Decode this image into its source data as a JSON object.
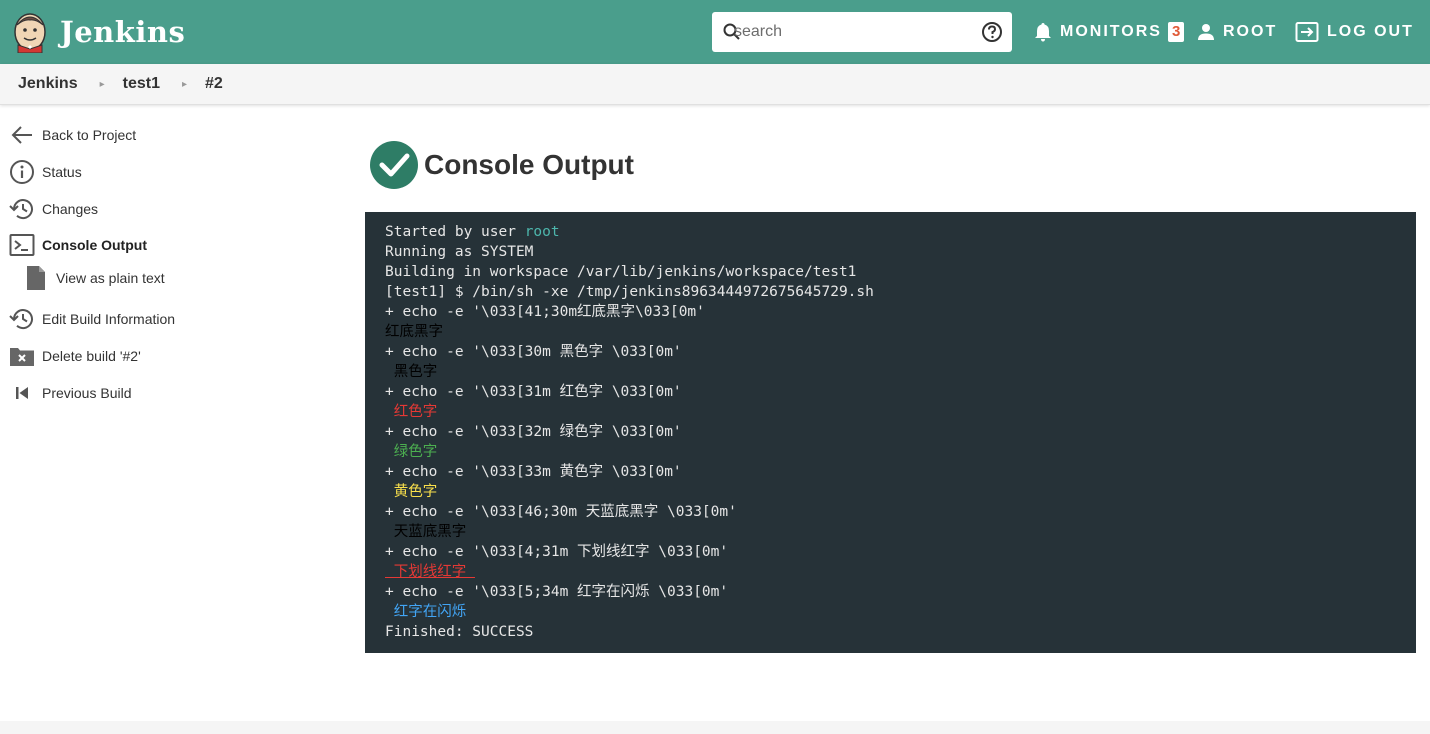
{
  "header": {
    "logo_text": "Jenkins",
    "search": {
      "placeholder": "search",
      "value": ""
    },
    "monitors_label": "MONITORS",
    "monitors_count": "3",
    "user_label": "ROOT",
    "logout_label": "LOG OUT",
    "bg_color": "#4a9e8c"
  },
  "breadcrumb": {
    "items": [
      "Jenkins",
      "test1",
      "#2"
    ]
  },
  "sidebar": {
    "items": [
      {
        "label": "Back to Project",
        "icon": "arrow-left-icon"
      },
      {
        "label": "Status",
        "icon": "info-icon"
      },
      {
        "label": "Changes",
        "icon": "history-icon"
      },
      {
        "label": "Console Output",
        "icon": "terminal-icon"
      },
      {
        "label": "View as plain text",
        "icon": "document-icon"
      },
      {
        "label": "Edit Build Information",
        "icon": "history-icon"
      },
      {
        "label": "Delete build '#2'",
        "icon": "folder-delete-icon"
      },
      {
        "label": "Previous Build",
        "icon": "skip-previous-icon"
      }
    ]
  },
  "main": {
    "title": "Console Output",
    "status_icon": "success-check-icon",
    "console": {
      "lines": [
        {
          "parts": [
            {
              "text": "Started by user "
            },
            {
              "text": "root",
              "color": "#4db6ac"
            }
          ]
        },
        {
          "parts": [
            {
              "text": "Running as SYSTEM"
            }
          ]
        },
        {
          "parts": [
            {
              "text": "Building in workspace /var/lib/jenkins/workspace/test1"
            }
          ]
        },
        {
          "parts": [
            {
              "text": "[test1] $ /bin/sh -xe /tmp/jenkins8963444972675645729.sh"
            }
          ]
        },
        {
          "parts": [
            {
              "text": "+ echo -e '\\033[41;30m红底黑字\\033[0m'"
            }
          ]
        },
        {
          "parts": [
            {
              "text": "红底黑字",
              "color": "#000000",
              "bg": "#263238"
            }
          ]
        },
        {
          "parts": [
            {
              "text": "+ echo -e '\\033[30m 黑色字 \\033[0m'"
            }
          ]
        },
        {
          "parts": [
            {
              "text": " 黑色字 ",
              "color": "#000000"
            }
          ]
        },
        {
          "parts": [
            {
              "text": "+ echo -e '\\033[31m 红色字 \\033[0m'"
            }
          ]
        },
        {
          "parts": [
            {
              "text": " 红色字 ",
              "color": "#e53935"
            }
          ]
        },
        {
          "parts": [
            {
              "text": "+ echo -e '\\033[32m 绿色字 \\033[0m'"
            }
          ]
        },
        {
          "parts": [
            {
              "text": " 绿色字 ",
              "color": "#4caf50"
            }
          ]
        },
        {
          "parts": [
            {
              "text": "+ echo -e '\\033[33m 黄色字 \\033[0m'"
            }
          ]
        },
        {
          "parts": [
            {
              "text": " 黄色字 ",
              "color": "#f9e04b"
            }
          ]
        },
        {
          "parts": [
            {
              "text": "+ echo -e '\\033[46;30m 天蓝底黑字 \\033[0m'"
            }
          ]
        },
        {
          "parts": [
            {
              "text": " 天蓝底黑字 ",
              "color": "#000000"
            }
          ]
        },
        {
          "parts": [
            {
              "text": "+ echo -e '\\033[4;31m 下划线红字 \\033[0m'"
            }
          ]
        },
        {
          "parts": [
            {
              "text": " 下划线红字 ",
              "color": "#e53935",
              "underline": true
            }
          ]
        },
        {
          "parts": [
            {
              "text": "+ echo -e '\\033[5;34m 红字在闪烁 \\033[0m'"
            }
          ]
        },
        {
          "parts": [
            {
              "text": " 红字在闪烁",
              "color": "#42a5f5"
            }
          ]
        },
        {
          "parts": [
            {
              "text": "Finished: SUCCESS"
            }
          ]
        }
      ]
    }
  }
}
